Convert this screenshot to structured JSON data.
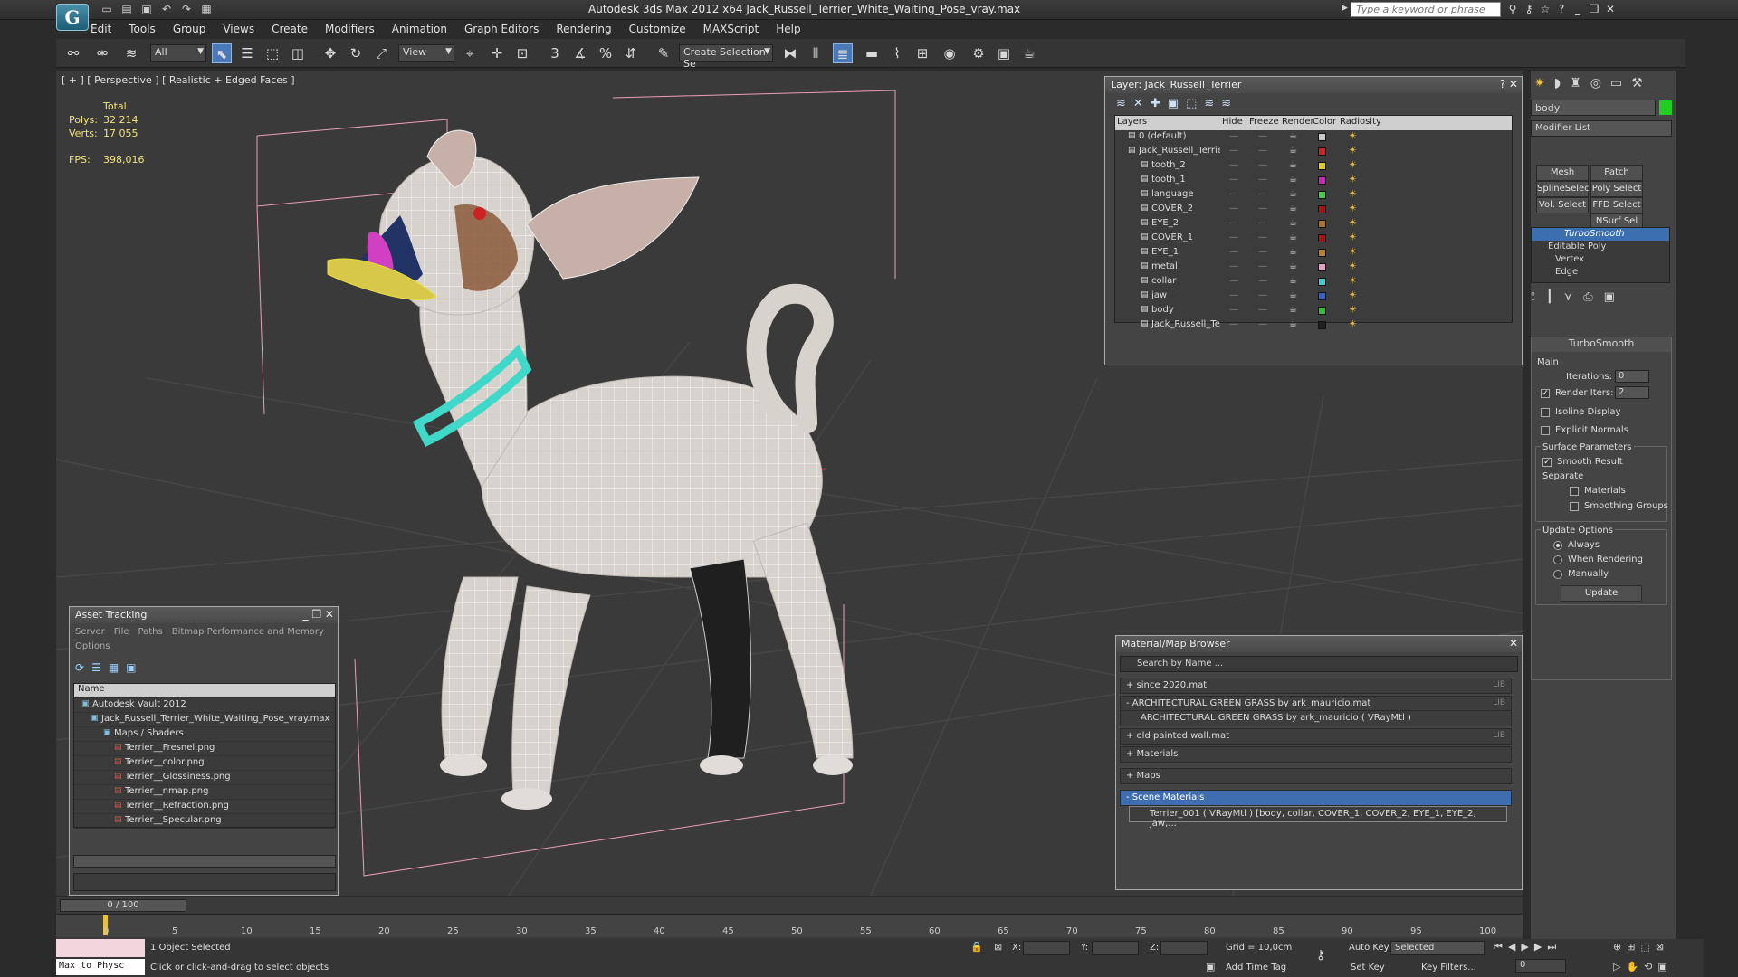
{
  "app": {
    "title": "Autodesk 3ds Max  2012 x64     Jack_Russell_Terrier_White_Waiting_Pose_vray.max",
    "search_placeholder": "Type a keyword or phrase"
  },
  "menu": [
    "Edit",
    "Tools",
    "Group",
    "Views",
    "Create",
    "Modifiers",
    "Animation",
    "Graph Editors",
    "Rendering",
    "Customize",
    "MAXScript",
    "Help"
  ],
  "toolbar": {
    "selection_filter": "All",
    "ref_coord": "View",
    "named_selection": "Create Selection Se"
  },
  "viewport": {
    "label": "[ + ] [ Perspective ] [ Realistic + Edged Faces ]",
    "stats": {
      "total_label": "Total",
      "polys_label": "Polys:",
      "polys": "32 214",
      "verts_label": "Verts:",
      "verts": "17 055",
      "fps_label": "FPS:",
      "fps": "398,016"
    }
  },
  "layer_panel": {
    "title": "Layer: Jack_Russell_Terrier",
    "headers": [
      "Layers",
      "Hide",
      "Freeze",
      "Render",
      "Color",
      "Radiosity"
    ],
    "rows": [
      {
        "name": "0 (default)",
        "color": "#c8c8c8"
      },
      {
        "name": "Jack_Russell_Terrier",
        "color": "#d02020"
      },
      {
        "name": "tooth_2",
        "color": "#e0d020"
      },
      {
        "name": "tooth_1",
        "color": "#d020c0"
      },
      {
        "name": "language",
        "color": "#40d040"
      },
      {
        "name": "COVER_2",
        "color": "#b01010"
      },
      {
        "name": "EYE_2",
        "color": "#b07020"
      },
      {
        "name": "COVER_1",
        "color": "#b01010"
      },
      {
        "name": "EYE_1",
        "color": "#c08020"
      },
      {
        "name": "metal",
        "color": "#e8a0c8"
      },
      {
        "name": "collar",
        "color": "#40d0d0"
      },
      {
        "name": "jaw",
        "color": "#3060d0"
      },
      {
        "name": "body",
        "color": "#30c030"
      },
      {
        "name": "Jack_Russell_Ter",
        "color": "#202020"
      }
    ]
  },
  "command_panel": {
    "object_name": "body",
    "object_color": "#22cc22",
    "modifier_list": "Modifier List",
    "buttons": [
      "Mesh Select",
      "Patch Select",
      "SplineSelect",
      "Poly Select",
      "Vol. Select",
      "FFD Select",
      "NSurf Sel"
    ],
    "stack": [
      "TurboSmooth",
      "Editable Poly",
      "Vertex",
      "Edge"
    ],
    "turbosmooth": {
      "title": "TurboSmooth",
      "main": "Main",
      "iterations_label": "Iterations:",
      "iterations": "0",
      "render_iters_label": "Render Iters:",
      "render_iters": "2",
      "isoline": "Isoline Display",
      "explicit": "Explicit Normals",
      "surface": "Surface Parameters",
      "smooth": "Smooth Result",
      "separate": "Separate",
      "materials": "Materials",
      "smoothing": "Smoothing Groups",
      "update_options": "Update Options",
      "always": "Always",
      "when_rendering": "When Rendering",
      "manually": "Manually",
      "update": "Update"
    }
  },
  "asset_tracking": {
    "title": "Asset Tracking",
    "menu1": [
      "Server",
      "File",
      "Paths",
      "Bitmap Performance and Memory"
    ],
    "menu2": "Options",
    "col": "Name",
    "rows": [
      "Autodesk Vault 2012",
      "Jack_Russell_Terrier_White_Waiting_Pose_vray.max",
      "Maps / Shaders",
      "Terrier__Fresnel.png",
      "Terrier__color.png",
      "Terrier__Glossiness.png",
      "Terrier__nmap.png",
      "Terrier__Refraction.png",
      "Terrier__Specular.png"
    ]
  },
  "material_browser": {
    "title": "Material/Map Browser",
    "search": "Search by Name ...",
    "rows": [
      {
        "label": "+ since 2020.mat",
        "lib": "LIB"
      },
      {
        "label": "- ARCHITECTURAL GREEN GRASS by ark_mauricio.mat",
        "lib": "LIB"
      },
      {
        "label": "ARCHITECTURAL GREEN GRASS by ark_mauricio  ( VRayMtl )",
        "lib": ""
      },
      {
        "label": "+ old painted wall.mat",
        "lib": "LIB"
      },
      {
        "label": "+ Materials",
        "lib": ""
      },
      {
        "label": "+ Maps",
        "lib": ""
      },
      {
        "label": "- Scene Materials",
        "lib": ""
      },
      {
        "label": "Terrier_001  ( VRayMtl )  [body, collar, COVER_1, COVER_2, EYE_1, EYE_2, jaw,...",
        "lib": ""
      }
    ]
  },
  "timeline": {
    "frame": "0 / 100",
    "ticks": [
      "0",
      "5",
      "10",
      "15",
      "20",
      "25",
      "30",
      "35",
      "40",
      "45",
      "50",
      "55",
      "60",
      "65",
      "70",
      "75",
      "80",
      "85",
      "90",
      "95",
      "100"
    ]
  },
  "status": {
    "maxscript": "Max to Physc",
    "selected": "1 Object Selected",
    "hint": "Click or click-and-drag to select objects",
    "x_label": "X:",
    "y_label": "Y:",
    "z_label": "Z:",
    "grid": "Grid = 10,0cm",
    "add_time_tag": "Add Time Tag",
    "auto_key": "Auto Key",
    "set_key": "Set Key",
    "selected_combo": "Selected",
    "key_filters": "Key Filters...",
    "frame_spinner": "0"
  }
}
